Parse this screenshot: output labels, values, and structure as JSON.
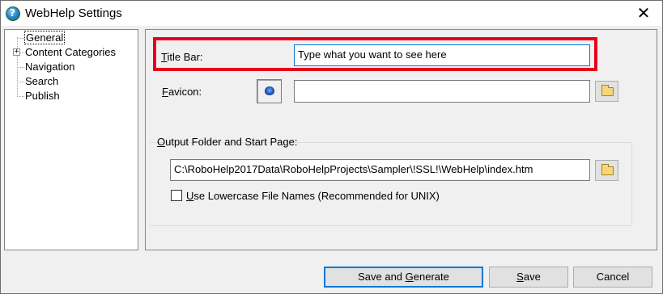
{
  "window": {
    "title": "WebHelp Settings",
    "close_glyph": "✕",
    "icon": "robohelp-app-icon"
  },
  "tree": {
    "items": [
      {
        "label": "General",
        "selected": true,
        "expandable": false
      },
      {
        "label": "Content Categories",
        "selected": false,
        "expandable": true,
        "expander": "+"
      },
      {
        "label": "Navigation",
        "selected": false,
        "expandable": false
      },
      {
        "label": "Search",
        "selected": false,
        "expandable": false
      },
      {
        "label": "Publish",
        "selected": false,
        "expandable": false
      }
    ]
  },
  "general": {
    "title_bar": {
      "label_hotkey": "T",
      "label_rest": "itle Bar:",
      "value": "Type what you want to see here"
    },
    "favicon": {
      "label_hotkey": "F",
      "label_rest": "avicon:",
      "value": "",
      "icon": "favicon-globe-icon",
      "browse_icon": "folder-open-icon"
    },
    "output": {
      "label_hotkey": "O",
      "label_rest": "utput Folder and Start Page:",
      "value": "C:\\RoboHelp2017Data\\RoboHelpProjects\\Sampler\\!SSL!\\WebHelp\\index.htm",
      "browse_icon": "folder-open-icon"
    },
    "lowercase": {
      "label_hotkey": "U",
      "label_rest": "se Lowercase File Names (Recommended for UNIX)",
      "checked": false
    }
  },
  "buttons": {
    "save_generate_pre": "Save and ",
    "save_generate_hotkey": "G",
    "save_generate_post": "enerate",
    "save_hotkey": "S",
    "save_rest": "ave",
    "cancel": "Cancel"
  },
  "colors": {
    "highlight": "#e8001c",
    "focus_border": "#0078d7"
  }
}
